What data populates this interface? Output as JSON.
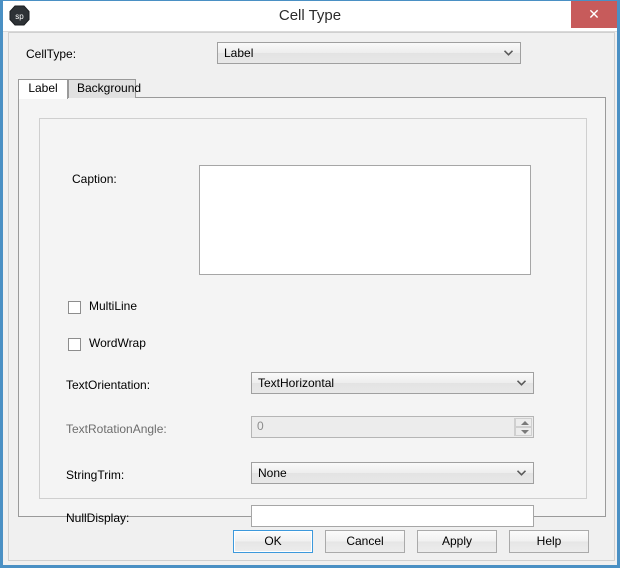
{
  "window": {
    "title": "Cell Type",
    "icon_name": "sp-app-icon",
    "icon_text": "sp",
    "close_label": "✕",
    "border_color": "#4a90c4",
    "close_color": "#c75b5b"
  },
  "top_field": {
    "label": "CellType:",
    "value": "Label",
    "chevron": "⌄",
    "options": [
      "Label"
    ]
  },
  "tabs": [
    {
      "label": "Label",
      "active": true
    },
    {
      "label": "Background",
      "active": false
    }
  ],
  "form": {
    "caption": {
      "label": "Caption:",
      "value": "",
      "placeholder": ""
    },
    "multiline": {
      "label": "MultiLine",
      "checked": false
    },
    "wordwrap": {
      "label": "WordWrap",
      "checked": false
    },
    "text_orientation": {
      "label": "TextOrientation:",
      "value": "TextHorizontal",
      "chevron": "⌄",
      "options": [
        "TextHorizontal"
      ]
    },
    "text_rotation_angle": {
      "label": "TextRotationAngle:",
      "value": "0",
      "disabled": true
    },
    "string_trim": {
      "label": "StringTrim:",
      "value": "None",
      "chevron": "⌄",
      "options": [
        "None"
      ]
    },
    "null_display": {
      "label": "NullDisplay:",
      "value": "",
      "placeholder": ""
    }
  },
  "footer": {
    "ok": "OK",
    "cancel": "Cancel",
    "apply": "Apply",
    "help": "Help"
  }
}
